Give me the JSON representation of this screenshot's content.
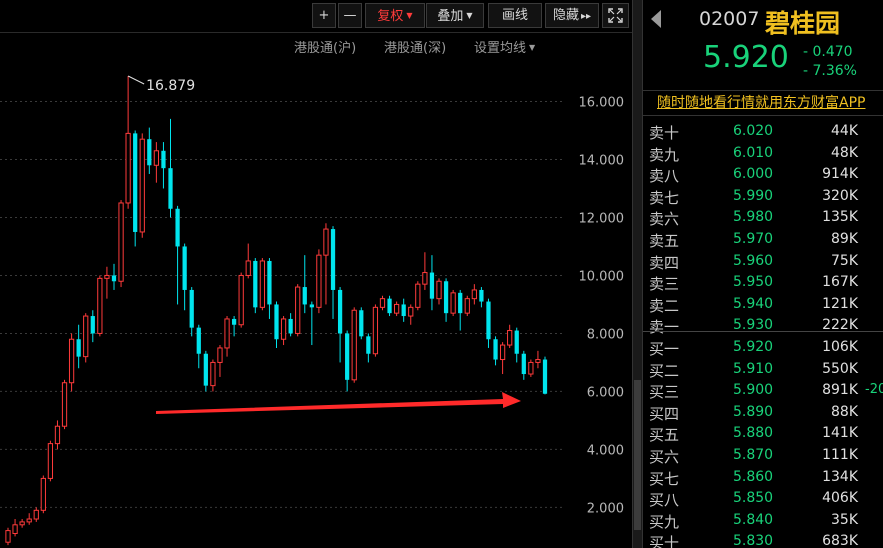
{
  "toolbar": {
    "plus": "+",
    "minus": "—",
    "fuquan": "复权",
    "diejia": "叠加",
    "huaxian": "画线",
    "yincang": "隐藏",
    "fastforward": "▸▸",
    "fullscreen_icon": "fullscreen-icon"
  },
  "subbar": {
    "hk_sh": "港股通(沪)",
    "hk_sz": "港股通(深)",
    "ma_settings": "设置均线"
  },
  "chart_data": {
    "type": "candlestick",
    "y_ticks": [
      "16.000",
      "14.000",
      "12.000",
      "10.000",
      "8.000",
      "6.000",
      "4.000",
      "2.000"
    ],
    "ylim": [
      0.6,
      17.5
    ],
    "max_label": "16.879",
    "max_value": 16.879,
    "annotation": "red-arrow-pointing-right",
    "colors": {
      "up": "#ff3b3b",
      "down": "#00e5ee",
      "grid": "#3a3a3a"
    },
    "candles": [
      [
        0.8,
        1.2,
        0.7,
        1.3
      ],
      [
        1.1,
        1.4,
        1.0,
        1.6
      ],
      [
        1.4,
        1.5,
        1.3,
        1.6
      ],
      [
        1.5,
        1.6,
        1.4,
        1.8
      ],
      [
        1.6,
        1.9,
        1.5,
        2.0
      ],
      [
        1.9,
        3.0,
        1.8,
        3.1
      ],
      [
        3.0,
        4.2,
        2.9,
        4.3
      ],
      [
        4.2,
        4.8,
        4.0,
        5.0
      ],
      [
        4.8,
        6.3,
        4.7,
        6.4
      ],
      [
        6.3,
        7.8,
        6.0,
        8.0
      ],
      [
        7.8,
        7.2,
        6.8,
        8.3
      ],
      [
        7.2,
        8.6,
        7.0,
        8.7
      ],
      [
        8.6,
        8.0,
        7.7,
        8.8
      ],
      [
        8.0,
        9.9,
        7.9,
        10.0
      ],
      [
        9.9,
        10.0,
        9.2,
        10.3
      ],
      [
        10.0,
        9.8,
        9.5,
        10.4
      ],
      [
        9.8,
        12.5,
        9.6,
        12.6
      ],
      [
        12.5,
        14.9,
        12.3,
        16.879
      ],
      [
        14.9,
        11.5,
        11.0,
        15.0
      ],
      [
        11.5,
        14.7,
        11.3,
        14.9
      ],
      [
        14.7,
        13.8,
        13.5,
        15.1
      ],
      [
        13.8,
        14.3,
        13.2,
        14.6
      ],
      [
        14.3,
        13.7,
        13.0,
        14.6
      ],
      [
        13.7,
        12.3,
        12.0,
        15.4
      ],
      [
        12.3,
        11.0,
        9.0,
        12.4
      ],
      [
        11.0,
        9.5,
        8.8,
        11.1
      ],
      [
        9.5,
        8.2,
        7.9,
        9.6
      ],
      [
        8.2,
        7.3,
        6.8,
        8.3
      ],
      [
        7.3,
        6.2,
        6.0,
        7.4
      ],
      [
        6.2,
        7.0,
        6.0,
        7.1
      ],
      [
        7.0,
        7.5,
        6.5,
        7.6
      ],
      [
        7.5,
        8.5,
        7.2,
        8.6
      ],
      [
        8.5,
        8.3,
        7.9,
        8.6
      ],
      [
        8.3,
        10.0,
        8.2,
        10.1
      ],
      [
        10.0,
        10.5,
        9.9,
        11.1
      ],
      [
        10.5,
        8.9,
        8.7,
        10.6
      ],
      [
        8.9,
        10.5,
        8.8,
        10.6
      ],
      [
        10.5,
        9.0,
        8.5,
        10.6
      ],
      [
        9.0,
        7.8,
        7.5,
        9.1
      ],
      [
        7.8,
        8.5,
        7.6,
        8.6
      ],
      [
        8.5,
        8.0,
        7.9,
        8.7
      ],
      [
        8.0,
        9.6,
        7.9,
        9.7
      ],
      [
        9.6,
        9.0,
        8.7,
        10.7
      ],
      [
        9.0,
        8.9,
        7.6,
        9.1
      ],
      [
        8.9,
        10.7,
        8.7,
        10.9
      ],
      [
        10.7,
        11.6,
        9.0,
        11.8
      ],
      [
        11.6,
        9.5,
        8.5,
        11.7
      ],
      [
        9.5,
        8.0,
        7.0,
        9.6
      ],
      [
        8.0,
        6.4,
        6.0,
        8.1
      ],
      [
        6.4,
        8.8,
        6.3,
        8.9
      ],
      [
        8.8,
        7.9,
        7.8,
        8.9
      ],
      [
        7.9,
        7.3,
        7.0,
        8.0
      ],
      [
        7.3,
        8.9,
        7.2,
        9.0
      ],
      [
        8.9,
        9.2,
        8.8,
        9.3
      ],
      [
        9.2,
        8.7,
        8.6,
        9.3
      ],
      [
        8.7,
        9.0,
        8.6,
        9.1
      ],
      [
        9.0,
        8.6,
        8.4,
        9.2
      ],
      [
        8.6,
        8.9,
        8.3,
        9.0
      ],
      [
        8.9,
        9.7,
        8.8,
        9.8
      ],
      [
        9.7,
        10.1,
        9.5,
        10.8
      ],
      [
        10.1,
        9.2,
        8.8,
        10.7
      ],
      [
        9.2,
        9.8,
        9.0,
        9.9
      ],
      [
        9.8,
        8.7,
        8.4,
        9.9
      ],
      [
        8.7,
        9.4,
        8.6,
        9.5
      ],
      [
        9.4,
        8.7,
        8.1,
        9.5
      ],
      [
        8.7,
        9.2,
        8.6,
        9.3
      ],
      [
        9.2,
        9.5,
        9.0,
        9.7
      ],
      [
        9.5,
        9.1,
        8.9,
        9.6
      ],
      [
        9.1,
        7.8,
        7.5,
        9.2
      ],
      [
        7.8,
        7.1,
        6.9,
        7.9
      ],
      [
        7.1,
        7.6,
        6.6,
        7.7
      ],
      [
        7.6,
        8.1,
        7.5,
        8.3
      ],
      [
        8.1,
        7.3,
        7.0,
        8.2
      ],
      [
        7.3,
        6.6,
        6.4,
        7.4
      ],
      [
        6.6,
        7.0,
        6.5,
        7.1
      ],
      [
        7.0,
        7.1,
        6.8,
        7.4
      ],
      [
        7.1,
        5.92,
        5.9,
        7.2
      ]
    ]
  },
  "panel": {
    "back_icon": "back-arrow-icon",
    "code": "02007",
    "name": "碧桂园",
    "price": "5.920",
    "change": "- 0.470",
    "change_pct": "- 7.36%",
    "promo": "随时随地看行情就用东方财富APP",
    "asks": [
      {
        "label": "卖十",
        "price": "6.020",
        "vol": "44K"
      },
      {
        "label": "卖九",
        "price": "6.010",
        "vol": "48K"
      },
      {
        "label": "卖八",
        "price": "6.000",
        "vol": "914K"
      },
      {
        "label": "卖七",
        "price": "5.990",
        "vol": "320K"
      },
      {
        "label": "卖六",
        "price": "5.980",
        "vol": "135K"
      },
      {
        "label": "卖五",
        "price": "5.970",
        "vol": "89K"
      },
      {
        "label": "卖四",
        "price": "5.960",
        "vol": "75K"
      },
      {
        "label": "卖三",
        "price": "5.950",
        "vol": "167K"
      },
      {
        "label": "卖二",
        "price": "5.940",
        "vol": "121K"
      },
      {
        "label": "卖一",
        "price": "5.930",
        "vol": "222K"
      }
    ],
    "bids": [
      {
        "label": "买一",
        "price": "5.920",
        "vol": "106K",
        "extra": ""
      },
      {
        "label": "买二",
        "price": "5.910",
        "vol": "550K",
        "extra": ""
      },
      {
        "label": "买三",
        "price": "5.900",
        "vol": "891K",
        "extra": "-20"
      },
      {
        "label": "买四",
        "price": "5.890",
        "vol": "88K",
        "extra": ""
      },
      {
        "label": "买五",
        "price": "5.880",
        "vol": "141K",
        "extra": ""
      },
      {
        "label": "买六",
        "price": "5.870",
        "vol": "111K",
        "extra": ""
      },
      {
        "label": "买七",
        "price": "5.860",
        "vol": "134K",
        "extra": ""
      },
      {
        "label": "买八",
        "price": "5.850",
        "vol": "406K",
        "extra": ""
      },
      {
        "label": "买九",
        "price": "5.840",
        "vol": "35K",
        "extra": ""
      },
      {
        "label": "买十",
        "price": "5.830",
        "vol": "683K",
        "extra": ""
      }
    ]
  }
}
